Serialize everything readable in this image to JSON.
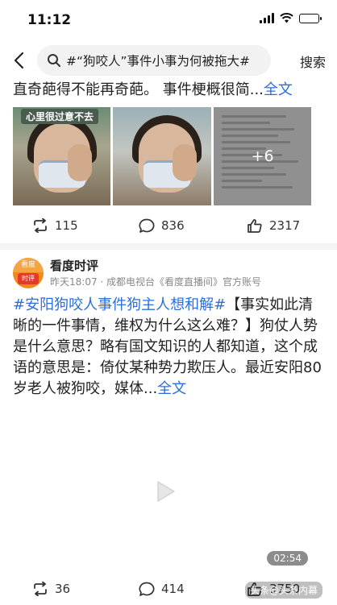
{
  "status_bar": {
    "time": "11:12"
  },
  "header": {
    "search_query": "#“狗咬人”事件小事为何被拖大#",
    "search_button": "搜索"
  },
  "post1": {
    "text": "直奇葩得不能再奇葩。 事件梗概很简...",
    "expand_link": "全文",
    "thumb_caption": "心里很过意不去",
    "more_images": "+6",
    "actions": {
      "repost": "115",
      "comment": "836",
      "like": "2317"
    }
  },
  "post2": {
    "avatar_top": "看度",
    "avatar_bottom": "时评",
    "author": "看度时评",
    "meta": "昨天18:07 · 成都电视台《看度直播间》官方账号",
    "hashtag": "#安阳狗咬人事件狗主人想和解#",
    "text": "【事实如此清晰的一件事情，维权为什么这么难？】狗仗人势是什么意思？略有国文知识的人都知道，这个成语的意思是：倚仗某种势力欺压人。最近安阳80岁老人被狗咬，媒体...",
    "expand_link": "全文",
    "video_duration": "02:54",
    "actions": {
      "repost": "36",
      "comment": "414",
      "like": "3750"
    }
  },
  "watermark": "头条@头条内幕"
}
